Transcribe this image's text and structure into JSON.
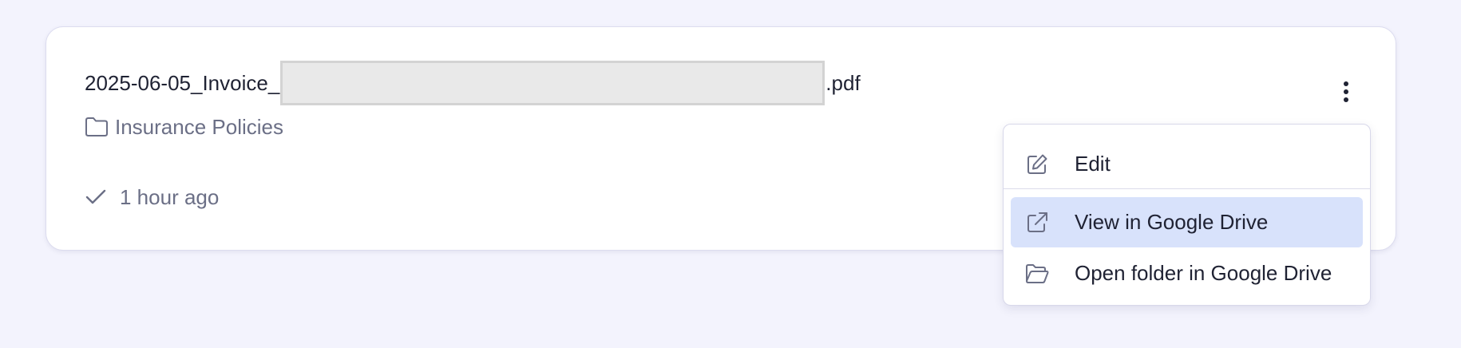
{
  "file": {
    "name_prefix": "2025-06-05_Invoice_",
    "name_suffix": ".pdf",
    "folder": "Insurance Policies",
    "status_time": "1 hour ago"
  },
  "menu": {
    "items": [
      {
        "label": "Edit",
        "icon": "edit-icon"
      },
      {
        "label": "View in Google Drive",
        "icon": "external-link-icon",
        "highlighted": true
      },
      {
        "label": "Open folder in Google Drive",
        "icon": "folder-open-icon"
      }
    ]
  },
  "colors": {
    "page_bg": "#f3f3fd",
    "card_bg": "#ffffff",
    "text_primary": "#1f2233",
    "text_muted": "#6b6f86",
    "menu_highlight": "#d8e2fb",
    "redaction": "#e9e9e9"
  }
}
